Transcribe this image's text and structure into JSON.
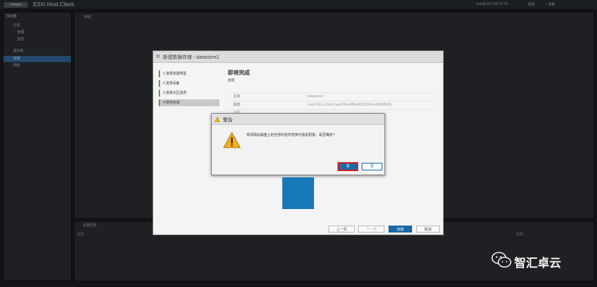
{
  "app": {
    "title": "ESXi Host Client",
    "logo": "vmware",
    "user": "root@192.168.10.10",
    "help": "帮助",
    "search": "搜索"
  },
  "navigator": {
    "title": "导航器",
    "items": [
      "主机",
      "管理",
      "监控",
      "虚拟机",
      "存储",
      "网络"
    ]
  },
  "content": {
    "tab_title": "存储"
  },
  "tasks": {
    "title": "近期任务",
    "col1": "任务",
    "col2": "结果"
  },
  "wizard": {
    "title": "新建数据存储 - datastore2",
    "steps": [
      "1 选择创建类型",
      "2 选择设备",
      "3 选择分区选项",
      "4 即将完成"
    ],
    "heading": "即将完成",
    "subheading": "摘要",
    "rows": [
      {
        "key": "名称",
        "value": "datastore2"
      },
      {
        "key": "磁盘",
        "value": "Local DELL Disk (naa.6f4ee080a4002c5d4-a99b55fc8)"
      },
      {
        "key": "分区",
        "value": ""
      }
    ],
    "buttons": {
      "back": "上一页",
      "next": "下一页",
      "finish": "完成",
      "cancel": "取消"
    }
  },
  "alert": {
    "title": "警告",
    "message": "将清除此磁盘上的全部内容并替换为指定配置，是否确定?",
    "ok": "是",
    "no": "否"
  },
  "watermark": {
    "text": "智汇卓云"
  },
  "colors": {
    "accent": "#1c6aa8",
    "highlight": "#d81c1c",
    "disk": "#1779b8",
    "step_marker": "#5aa046"
  }
}
